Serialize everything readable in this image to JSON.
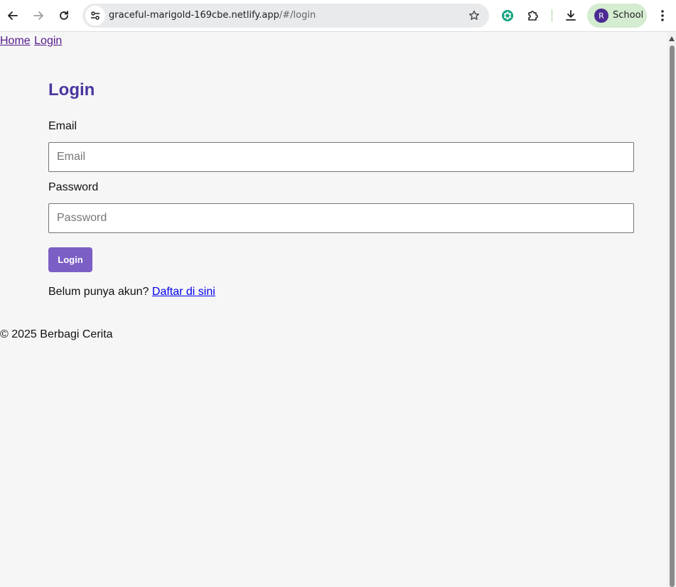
{
  "browser": {
    "url_host": "graceful-marigold-169cbe.netlify.app",
    "url_path": "/#/login",
    "profile_initial": "R",
    "profile_name": "School"
  },
  "nav": {
    "home": "Home",
    "login": "Login"
  },
  "login": {
    "title": "Login",
    "email_label": "Email",
    "email_placeholder": "Email",
    "email_value": "",
    "password_label": "Password",
    "password_placeholder": "Password",
    "password_value": "",
    "button_label": "Login",
    "register_prompt": "Belum punya akun?",
    "register_link": "Daftar di sini"
  },
  "footer": {
    "text": "© 2025 Berbagi Cerita"
  },
  "colors": {
    "accent": "#7c5fc5",
    "title": "#4b36a0",
    "background": "#f6f6f6"
  }
}
